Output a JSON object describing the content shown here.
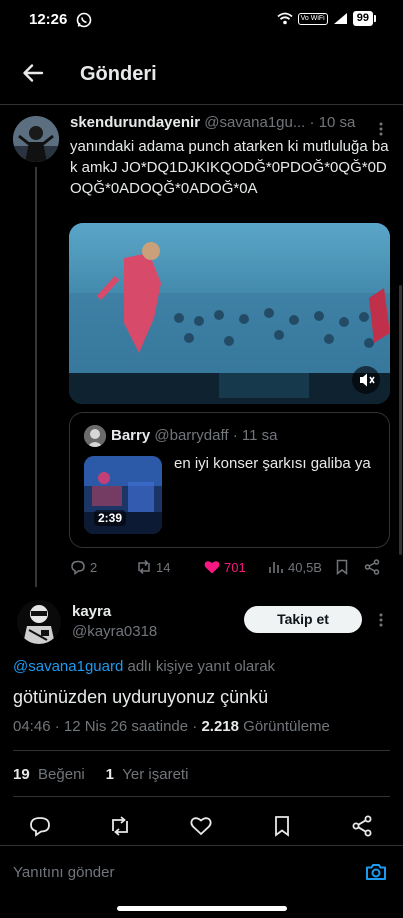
{
  "status_bar": {
    "time": "12:26",
    "vowifi": "Vo WiFi",
    "battery": "99"
  },
  "nav": {
    "title": "Gönderi"
  },
  "tweet1": {
    "name": "skendurundayenir",
    "handle": "@savana1gu...",
    "time": "· 10 sa",
    "text": "yanındaki adama punch atarken ki mutluluğa bak amkJ JO*DQ1DJKIKQODĞ*0PDOĞ*0QĞ*0DOQĞ*0ADOQĞ*0ADOĞ*0A",
    "quote": {
      "name": "Barry",
      "handle": "@barrydaff",
      "time": "· 11 sa",
      "text": "en iyi konser şarkısı galiba ya",
      "video_duration": "2:39"
    },
    "actions": {
      "replies": "2",
      "reposts": "14",
      "likes": "701",
      "views": "40,5B"
    }
  },
  "tweet2": {
    "name": "kayra",
    "handle": "@kayra0318",
    "follow_label": "Takip et",
    "reply_mention": "@savana1guard",
    "reply_suffix": " adlı kişiye yanıt olarak",
    "text": "götünüzden uyduruyonuz çünkü",
    "meta_prefix": "04:46 · 12 Nis 26 saatinde · ",
    "views_count": "2.218",
    "views_label": " Görüntüleme",
    "likes_count": "19",
    "likes_label": "Beğeni",
    "bookmarks_count": "1",
    "bookmarks_label": "Yer işareti"
  },
  "composer": {
    "placeholder": "Yanıtını gönder"
  },
  "colors": {
    "accent": "#1d9bf0",
    "like": "#f91880",
    "muted": "#71767b",
    "background": "#000000"
  }
}
